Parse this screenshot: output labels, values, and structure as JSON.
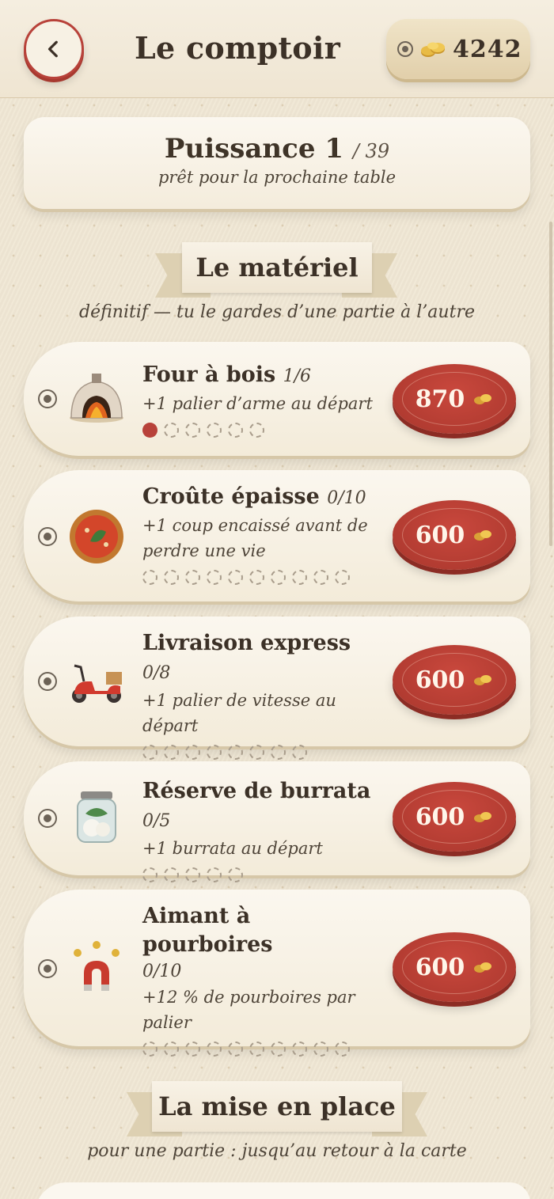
{
  "header": {
    "title": "Le comptoir",
    "coins": "4242",
    "icons": {
      "back": "chevron-left-icon",
      "coin": "coin-stack-icon"
    }
  },
  "power": {
    "title": "Puissance 1",
    "fraction": "/ 39",
    "subtitle": "prêt pour la prochaine table"
  },
  "materiel": {
    "title": "Le matériel",
    "subtitle": "définitif — tu le gardes d’une partie à l’autre",
    "items": [
      {
        "name": "Four à bois",
        "level": "1/6",
        "desc_lines": [
          "+1 palier d’arme au départ"
        ],
        "price": "870",
        "levels_owned": 1,
        "levels_total": 6,
        "icon": "wood-oven-icon"
      },
      {
        "name": "Croûte épaisse",
        "level": "0/10",
        "desc_lines": [
          "+1 coup encaissé avant de",
          "perdre une vie"
        ],
        "price": "600",
        "levels_owned": 0,
        "levels_total": 10,
        "icon": "pizza-icon"
      },
      {
        "name": "Livraison express",
        "level": "0/8",
        "desc_lines": [
          "+1 palier de vitesse au",
          "départ"
        ],
        "price": "600",
        "levels_owned": 0,
        "levels_total": 8,
        "icon": "scooter-icon"
      },
      {
        "name": "Réserve de burrata",
        "level": "0/5",
        "desc_lines": [
          "+1 burrata au départ"
        ],
        "price": "600",
        "levels_owned": 0,
        "levels_total": 5,
        "icon": "burrata-jar-icon"
      },
      {
        "name": "Aimant à pourboires",
        "level": "0/10",
        "desc_lines": [
          "+12 % de pourboires par",
          "palier"
        ],
        "price": "600",
        "levels_owned": 0,
        "levels_total": 10,
        "icon": "magnet-coins-icon"
      }
    ]
  },
  "mise_en_place": {
    "title": "La mise en place",
    "subtitle": "pour une partie : jusqu’au retour à la carte"
  },
  "colors": {
    "accent_red": "#b8423a",
    "background": "#efe6d3",
    "text": "#3c3127"
  }
}
